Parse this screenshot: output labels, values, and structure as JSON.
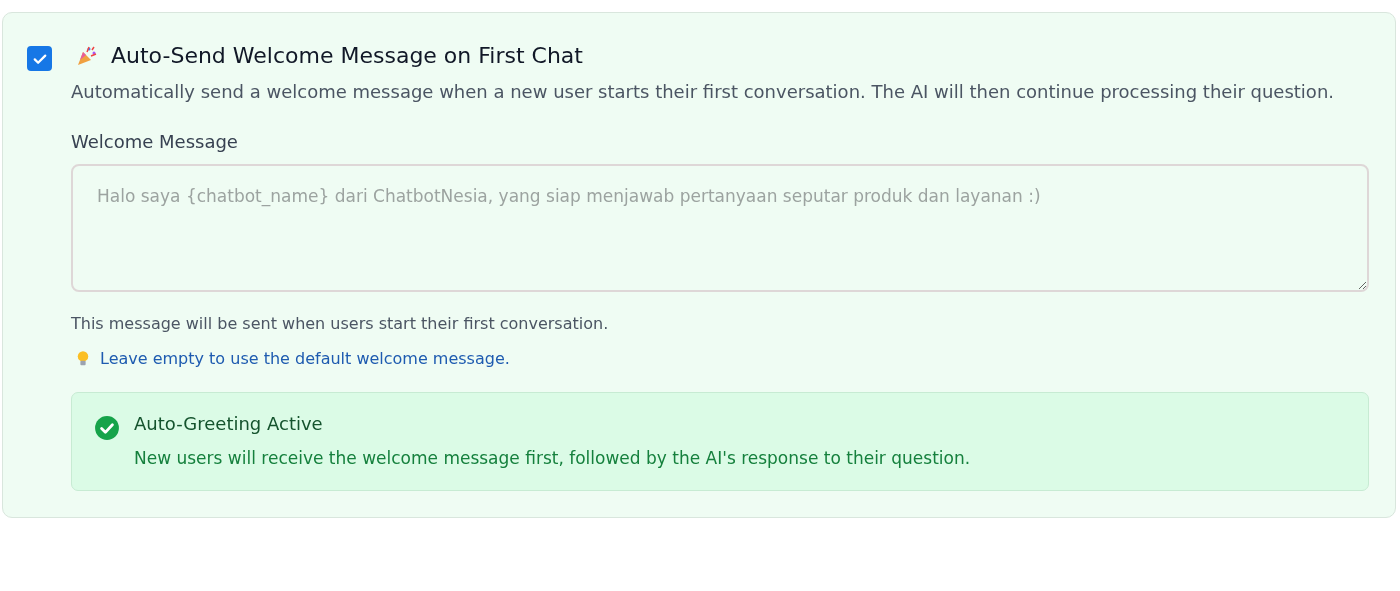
{
  "setting": {
    "checked": true,
    "title": "Auto-Send Welcome Message on First Chat",
    "description": "Automatically send a welcome message when a new user starts their first conversation. The AI will then continue processing their question."
  },
  "welcome_message": {
    "label": "Welcome Message",
    "placeholder": "Halo saya {chatbot_name} dari ChatbotNesia, yang siap menjawab pertanyaan seputar produk dan layanan :)",
    "help": "This message will be sent when users start their first conversation.",
    "tip": "Leave empty to use the default welcome message."
  },
  "status": {
    "active": true,
    "title": "Auto-Greeting Active",
    "message": "New users will receive the welcome message first, followed by the AI's response to their question."
  }
}
